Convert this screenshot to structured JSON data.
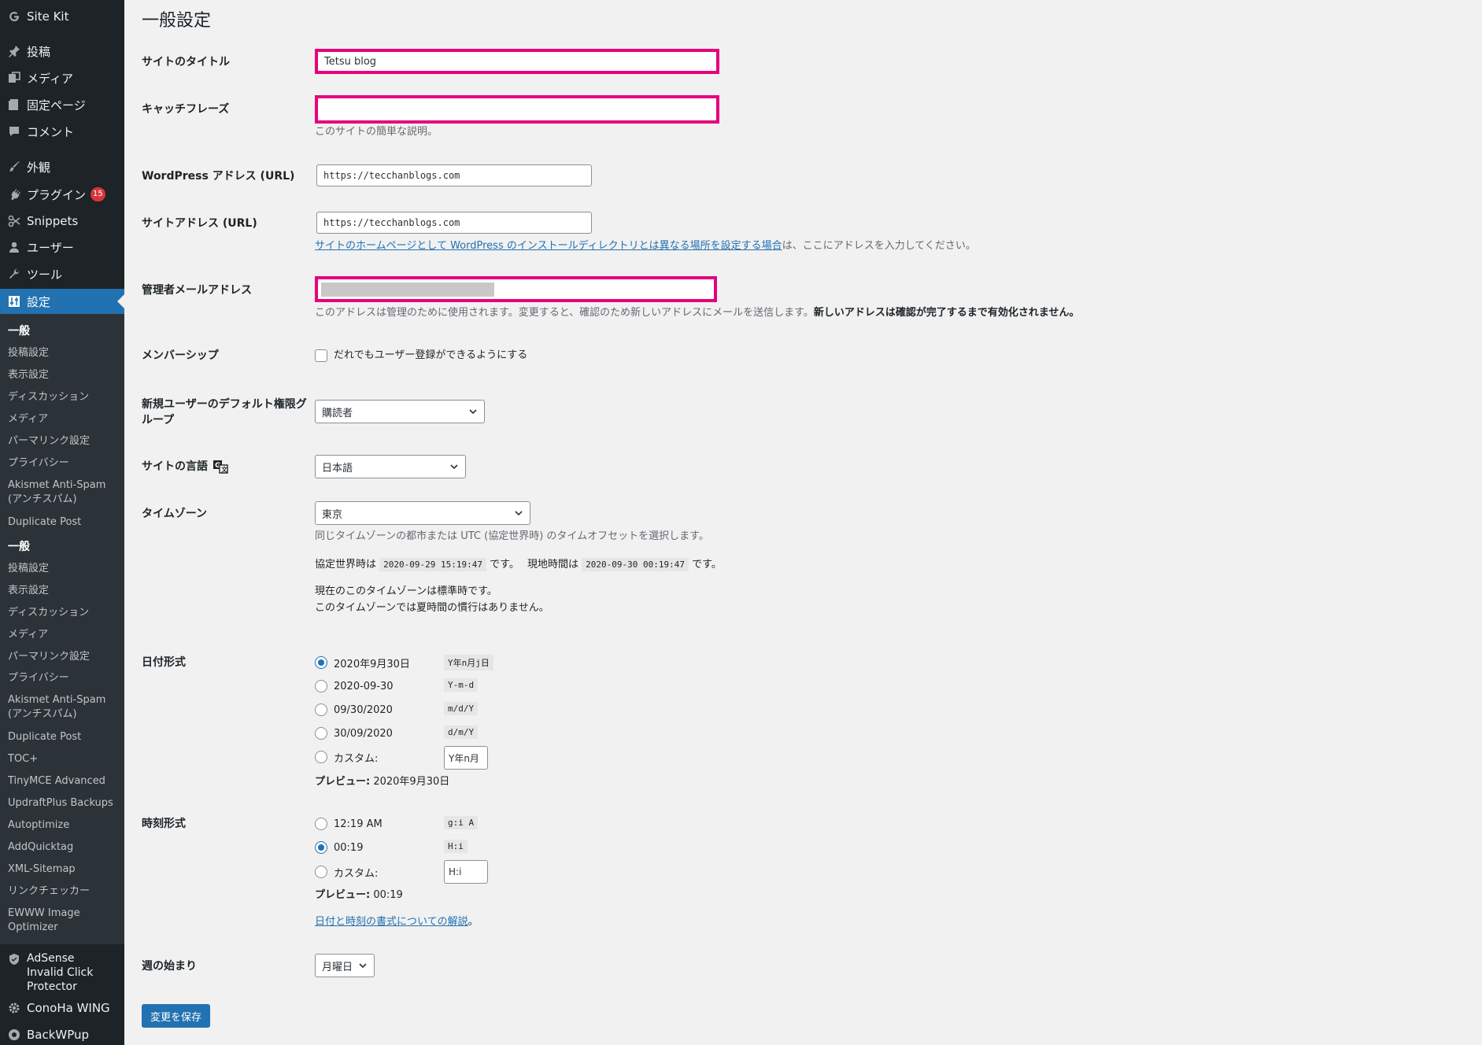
{
  "sidebar": {
    "top_items": [
      {
        "label": "Site Kit",
        "icon": "google-g-icon"
      },
      {
        "label": "投稿",
        "icon": "pin-icon"
      },
      {
        "label": "メディア",
        "icon": "media-icon"
      },
      {
        "label": "固定ページ",
        "icon": "page-icon"
      },
      {
        "label": "コメント",
        "icon": "comment-icon"
      },
      {
        "label": "外観",
        "icon": "brush-icon"
      },
      {
        "label": "プラグイン",
        "icon": "plugin-icon",
        "badge": "15"
      },
      {
        "label": "Snippets",
        "icon": "scissors-icon"
      },
      {
        "label": "ユーザー",
        "icon": "user-icon"
      },
      {
        "label": "ツール",
        "icon": "wrench-icon"
      },
      {
        "label": "設定",
        "icon": "settings-icon"
      }
    ],
    "submenu_1": [
      "一般",
      "投稿設定",
      "表示設定",
      "ディスカッション",
      "メディア",
      "パーマリンク設定",
      "プライバシー",
      "Akismet Anti-Spam (アンチスパム)",
      "Duplicate Post"
    ],
    "submenu_2": [
      "一般",
      "投稿設定",
      "表示設定",
      "ディスカッション",
      "メディア",
      "パーマリンク設定",
      "プライバシー",
      "Akismet Anti-Spam (アンチスパム)",
      "Duplicate Post",
      "TOC+",
      "TinyMCE Advanced",
      "UpdraftPlus Backups",
      "Autoptimize",
      "AddQuicktag",
      "XML-Sitemap",
      "リンクチェッカー",
      "EWWW Image Optimizer"
    ],
    "bottom_items": [
      {
        "label": "AdSense Invalid Click Protector",
        "icon": "shield-icon"
      },
      {
        "label": "ConoHa WING",
        "icon": "gear-icon"
      },
      {
        "label": "BackWPup",
        "icon": "backwpup-icon"
      }
    ]
  },
  "page": {
    "title": "一般設定",
    "site_title": {
      "label": "サイトのタイトル",
      "value": "Tetsu blog"
    },
    "tagline": {
      "label": "キャッチフレーズ",
      "value": "",
      "description": "このサイトの簡単な説明。"
    },
    "wp_address": {
      "label": "WordPress アドレス (URL)",
      "value": "https://tecchanblogs.com"
    },
    "site_address": {
      "label": "サイトアドレス (URL)",
      "value": "https://tecchanblogs.com",
      "link_text": "サイトのホームページとして WordPress のインストールディレクトリとは異なる場所を設定する場合",
      "desc_after": "は、ここにアドレスを入力してください。"
    },
    "admin_email": {
      "label": "管理者メールアドレス",
      "description": "このアドレスは管理のために使用されます。変更すると、確認のため新しいアドレスにメールを送信します。",
      "description_bold": "新しいアドレスは確認が完了するまで有効化されません。"
    },
    "membership": {
      "label": "メンバーシップ",
      "checkbox_label": "だれでもユーザー登録ができるようにする"
    },
    "default_role": {
      "label": "新規ユーザーのデフォルト権限グループ",
      "value": "購読者"
    },
    "site_language": {
      "label": "サイトの言語",
      "value": "日本語"
    },
    "timezone": {
      "label": "タイムゾーン",
      "value": "東京",
      "description": "同じタイムゾーンの都市または UTC (協定世界時) のタイムオフセットを選択します。",
      "utc_prefix": "協定世界時は",
      "utc_time": "2020-09-29 15:19:47",
      "utc_suffix": "です。",
      "local_prefix": "現地時間は",
      "local_time": "2020-09-30 00:19:47",
      "local_suffix": "です。",
      "std_line1": "現在のこのタイムゾーンは標準時です。",
      "std_line2": "このタイムゾーンでは夏時間の慣行はありません。"
    },
    "date_format": {
      "label": "日付形式",
      "options": [
        {
          "label": "2020年9月30日",
          "code": "Y年n月j日"
        },
        {
          "label": "2020-09-30",
          "code": "Y-m-d"
        },
        {
          "label": "09/30/2020",
          "code": "m/d/Y"
        },
        {
          "label": "30/09/2020",
          "code": "d/m/Y"
        }
      ],
      "custom_label": "カスタム:",
      "custom_value": "Y年n月",
      "preview_label": "プレビュー:",
      "preview_value": "2020年9月30日"
    },
    "time_format": {
      "label": "時刻形式",
      "options": [
        {
          "label": "12:19 AM",
          "code": "g:i A"
        },
        {
          "label": "00:19",
          "code": "H:i"
        }
      ],
      "custom_label": "カスタム:",
      "custom_value": "H:i",
      "preview_label": "プレビュー:",
      "preview_value": "00:19",
      "doc_link": "日付と時刻の書式についての解説",
      "doc_suffix": "。"
    },
    "week_start": {
      "label": "週の始まり",
      "value": "月曜日"
    },
    "save_label": "変更を保存"
  }
}
